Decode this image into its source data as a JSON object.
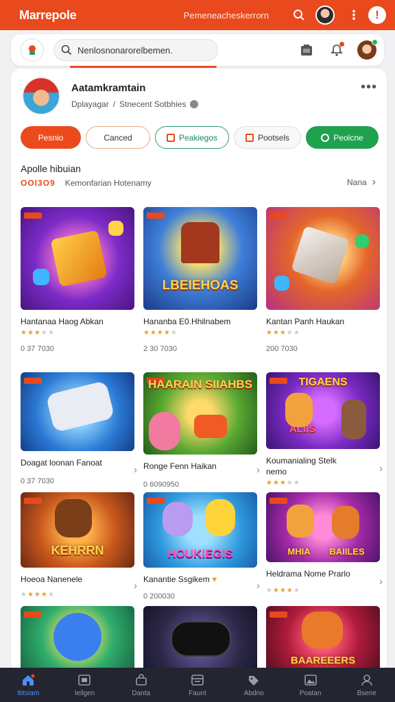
{
  "app": {
    "title": "Marrepole",
    "header_text": "Pemeneacheskerrorn"
  },
  "search": {
    "placeholder": "Nenlosnonarorelbemen."
  },
  "profile": {
    "name": "Aatamkramtain",
    "subtitle_left": "Dplayagar",
    "subtitle_sep": "/",
    "subtitle_right": "Stnecent Sotbhies"
  },
  "chips": [
    "Pesnio",
    "Canced",
    "Peakiegos",
    "Pootsels",
    "Peolcne"
  ],
  "section": {
    "title": "Apolle hibuian",
    "code": "OOI3O9",
    "subtitle": "Kemonfarian Hotenamy",
    "see_more": "Nana"
  },
  "games": [
    {
      "title": "Hantanaa Haog Abkan",
      "rating": 3.5,
      "count": "0 37 7030"
    },
    {
      "title": "Hananba E0.Hhilnabem",
      "rating": 4,
      "count": "2 30 7030"
    },
    {
      "title": "Kantan Panh Haukan",
      "rating": 3.5,
      "count": "200 7030"
    },
    {
      "title": "Doagat loonan Fanoat",
      "count": "0 37 7030"
    },
    {
      "title": "Ronge Fenn Haikan",
      "count": "0 6090950"
    },
    {
      "title": "Koumanialing Stelk",
      "title2": "nemo",
      "rating": 3.5
    },
    {
      "title": "Hoeoa Nanenele",
      "rating": 3
    },
    {
      "title": "Kanantie Ssgikem",
      "count": "0 200030"
    },
    {
      "title": "Heldrama Nome Prarlo",
      "rating": 3.5
    },
    {
      "title": ""
    },
    {
      "title": ""
    },
    {
      "title": ""
    }
  ],
  "thumb_titles": {
    "t2": "LBEIEHOAS",
    "t5": "HAARAIN SIIAHBS",
    "t6": "TIGAENS",
    "t6b": "ALIIS",
    "t7": "KEHRRN",
    "t8": "HOUKIEGIS",
    "t9": "MHIA",
    "t9b": "BAIILES",
    "t12": "BAAREEERS"
  },
  "nav": [
    {
      "label": "Ibtsiam",
      "icon": "home-icon"
    },
    {
      "label": "Ieilgen",
      "icon": "tablet-icon"
    },
    {
      "label": "Danta",
      "icon": "bag-icon"
    },
    {
      "label": "Faunt",
      "icon": "calendar-icon"
    },
    {
      "label": "Abdno",
      "icon": "tag-icon"
    },
    {
      "label": "Poatan",
      "icon": "image-icon"
    },
    {
      "label": "Bsene",
      "icon": "person-icon"
    }
  ],
  "colors": {
    "brand": "#e8491d",
    "green": "#1fa24e",
    "nav_bg": "#232530",
    "nav_active": "#4d8ff5"
  }
}
